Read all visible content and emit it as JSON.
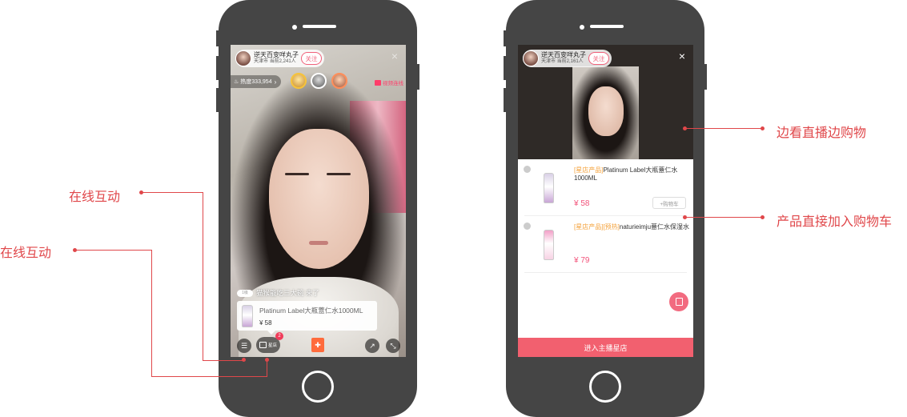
{
  "live_screen": {
    "streamer_name": "逆天百变咩丸子",
    "location_viewers": "天津市 当前2,241人",
    "follow_label": "关注",
    "close_icon": "×",
    "heat_label": "热度333,954",
    "heat_arrow": "›",
    "video_link_label": "视频连线",
    "chat_badge": "1级",
    "chat_message": "猫猴能吃三大碗 来了",
    "product_card": {
      "name": "Platinum Label大瓶薏仁水1000ML",
      "price": "¥ 58"
    },
    "shop_button_label": "星店",
    "shop_badge_count": "2",
    "icons": [
      "chat-icon",
      "shop-bag-icon",
      "gift-icon",
      "share-icon",
      "minimize-icon"
    ]
  },
  "shop_screen": {
    "streamer_name": "逆天百变咩丸子",
    "location_viewers": "天津市 当前2,161人",
    "follow_label": "关注",
    "close_icon": "×",
    "products": [
      {
        "tag": "[星店产品]",
        "title": "Platinum Label大瓶薏仁水1000ML",
        "price": "¥ 58",
        "cart_label": "+购物车"
      },
      {
        "tag": "[星店产品][预热]",
        "title": "naturieimju薏仁水保湿水",
        "price": "¥ 79",
        "cart_label": ""
      }
    ],
    "enter_store_label": "进入主播星店"
  },
  "callouts": {
    "left_top": "在线互动",
    "left_bottom": "在线互动",
    "right_top": "边看直播边购物",
    "right_bottom": "产品直接加入购物车"
  },
  "colors": {
    "accent": "#e0474a",
    "pink": "#f2606f",
    "price": "#f2527a",
    "phone_body": "#454545"
  }
}
